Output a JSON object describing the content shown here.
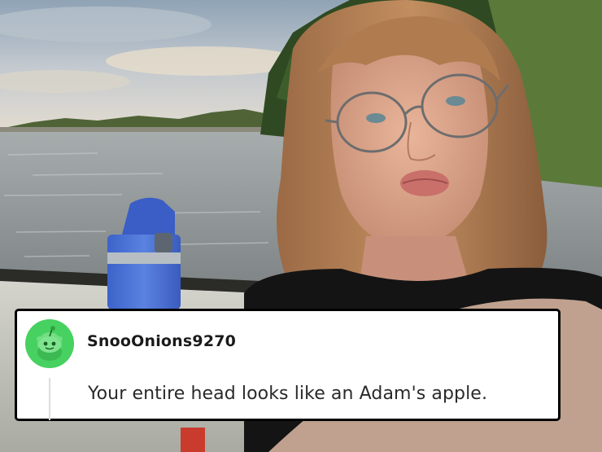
{
  "comment": {
    "username": "SnooOnions9270",
    "text": "Your entire head looks like an Adam's apple."
  },
  "colors": {
    "avatar_background": "#46d160",
    "card_background": "#ffffff",
    "card_border": "#000000",
    "text_primary": "#1a1a1b"
  },
  "icons": {
    "avatar": "reddit-snoo-icon"
  }
}
